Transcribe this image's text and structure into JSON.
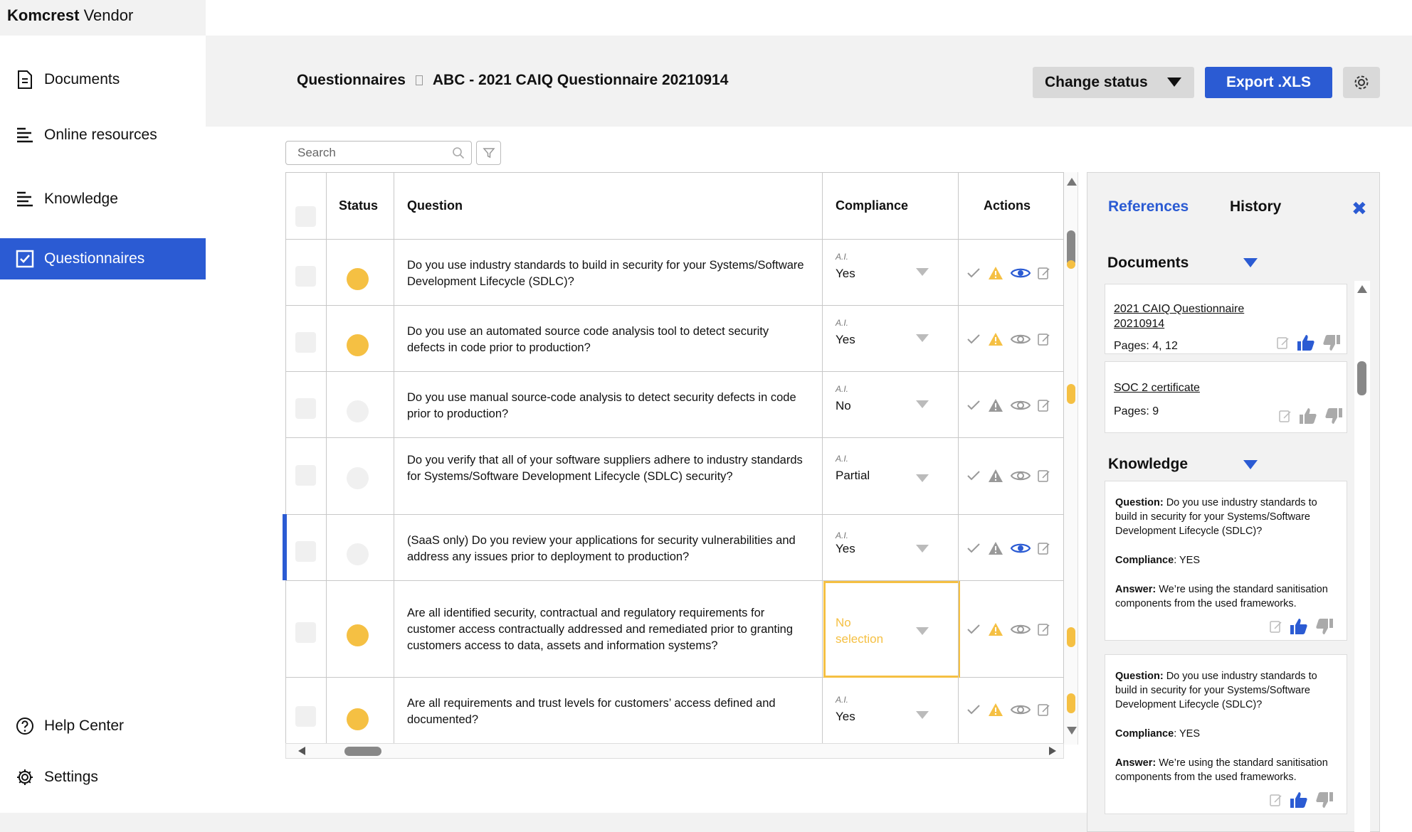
{
  "app": {
    "brand_bold": "Komcrest",
    "brand_rest": " Vendor"
  },
  "sidebar": {
    "items": [
      {
        "label": "Documents",
        "icon": "document-icon"
      },
      {
        "label": "Online resources",
        "icon": "list-icon"
      },
      {
        "label": "Knowledge",
        "icon": "list-icon"
      },
      {
        "label": "Questionnaires",
        "icon": "checkbox-icon",
        "active": true
      }
    ],
    "bottom": [
      {
        "label": "Help Center",
        "icon": "help-icon"
      },
      {
        "label": "Settings",
        "icon": "gear-icon"
      }
    ]
  },
  "header": {
    "breadcrumb_root": "Questionnaires",
    "breadcrumb_current": "ABC - 2021 CAIQ Questionnaire 20210914",
    "change_status_label": "Change status",
    "export_label": "Export .XLS"
  },
  "search": {
    "placeholder": "Search"
  },
  "table": {
    "columns": [
      "Status",
      "Question",
      "Compliance",
      "Actions"
    ],
    "ai_label": "A.I.",
    "rows": [
      {
        "status": "yellow",
        "question": "Do you use industry standards to build in security for your Systems/Software Development Lifecycle (SDLC)?",
        "compliance": "Yes",
        "warn": "yellow",
        "eye": "blue"
      },
      {
        "status": "yellow",
        "question": "Do you use an automated source code analysis tool to detect security defects in code prior to production?",
        "compliance": "Yes",
        "warn": "yellow",
        "eye": "gray"
      },
      {
        "status": "gray",
        "question": "Do you use manual source-code analysis to detect security defects in code prior to production?",
        "compliance": "No",
        "warn": "gray",
        "eye": "gray"
      },
      {
        "status": "gray",
        "question": "Do you verify that all of your software suppliers adhere to industry standards for Systems/Software Development Lifecycle (SDLC) security?",
        "compliance": "Partial",
        "warn": "gray",
        "eye": "gray"
      },
      {
        "status": "gray",
        "question": "(SaaS only) Do you review your applications for security vulnerabilities and address any issues prior to deployment to production?",
        "compliance": "Yes",
        "warn": "gray",
        "eye": "blue"
      },
      {
        "status": "yellow",
        "question": "Are all identified security, contractual and regulatory requirements for customer access contractually addressed and remediated prior to granting customers access to data, assets and information systems?",
        "compliance": "No selection",
        "warn": "yellow",
        "eye": "gray"
      },
      {
        "status": "yellow",
        "question": "Are all requirements and trust levels for customers’ access defined and documented?",
        "compliance": "Yes",
        "warn": "yellow",
        "eye": "gray"
      }
    ]
  },
  "panel": {
    "tab_references": "References",
    "tab_history": "History",
    "documents_title": "Documents",
    "documents": [
      {
        "name": "2021 CAIQ Questionnaire 20210914",
        "pages": "Pages: 4, 12",
        "liked": true
      },
      {
        "name": "SOC 2 certificate",
        "pages": "Pages: 9",
        "liked": false
      }
    ],
    "knowledge_title": "Knowledge",
    "knowledge": [
      {
        "q_label": "Question:",
        "q": " Do you use industry standards to build in security for your Systems/Software Development Lifecycle (SDLC)?",
        "c_label": "Compliance",
        "c": ": YES",
        "a_label": "Answer:",
        "a": " We’re using the standard sanitisation components from the used frameworks."
      },
      {
        "q_label": "Question:",
        "q": " Do you use industry standards to build in security for your Systems/Software Development Lifecycle (SDLC)?",
        "c_label": "Compliance",
        "c": ": YES",
        "a_label": "Answer:",
        "a": " We’re using the standard sanitisation components from the used frameworks."
      }
    ]
  },
  "colors": {
    "accent": "#2b5bd3",
    "warning": "#f5c043",
    "neutral": "#f2f2f2"
  }
}
